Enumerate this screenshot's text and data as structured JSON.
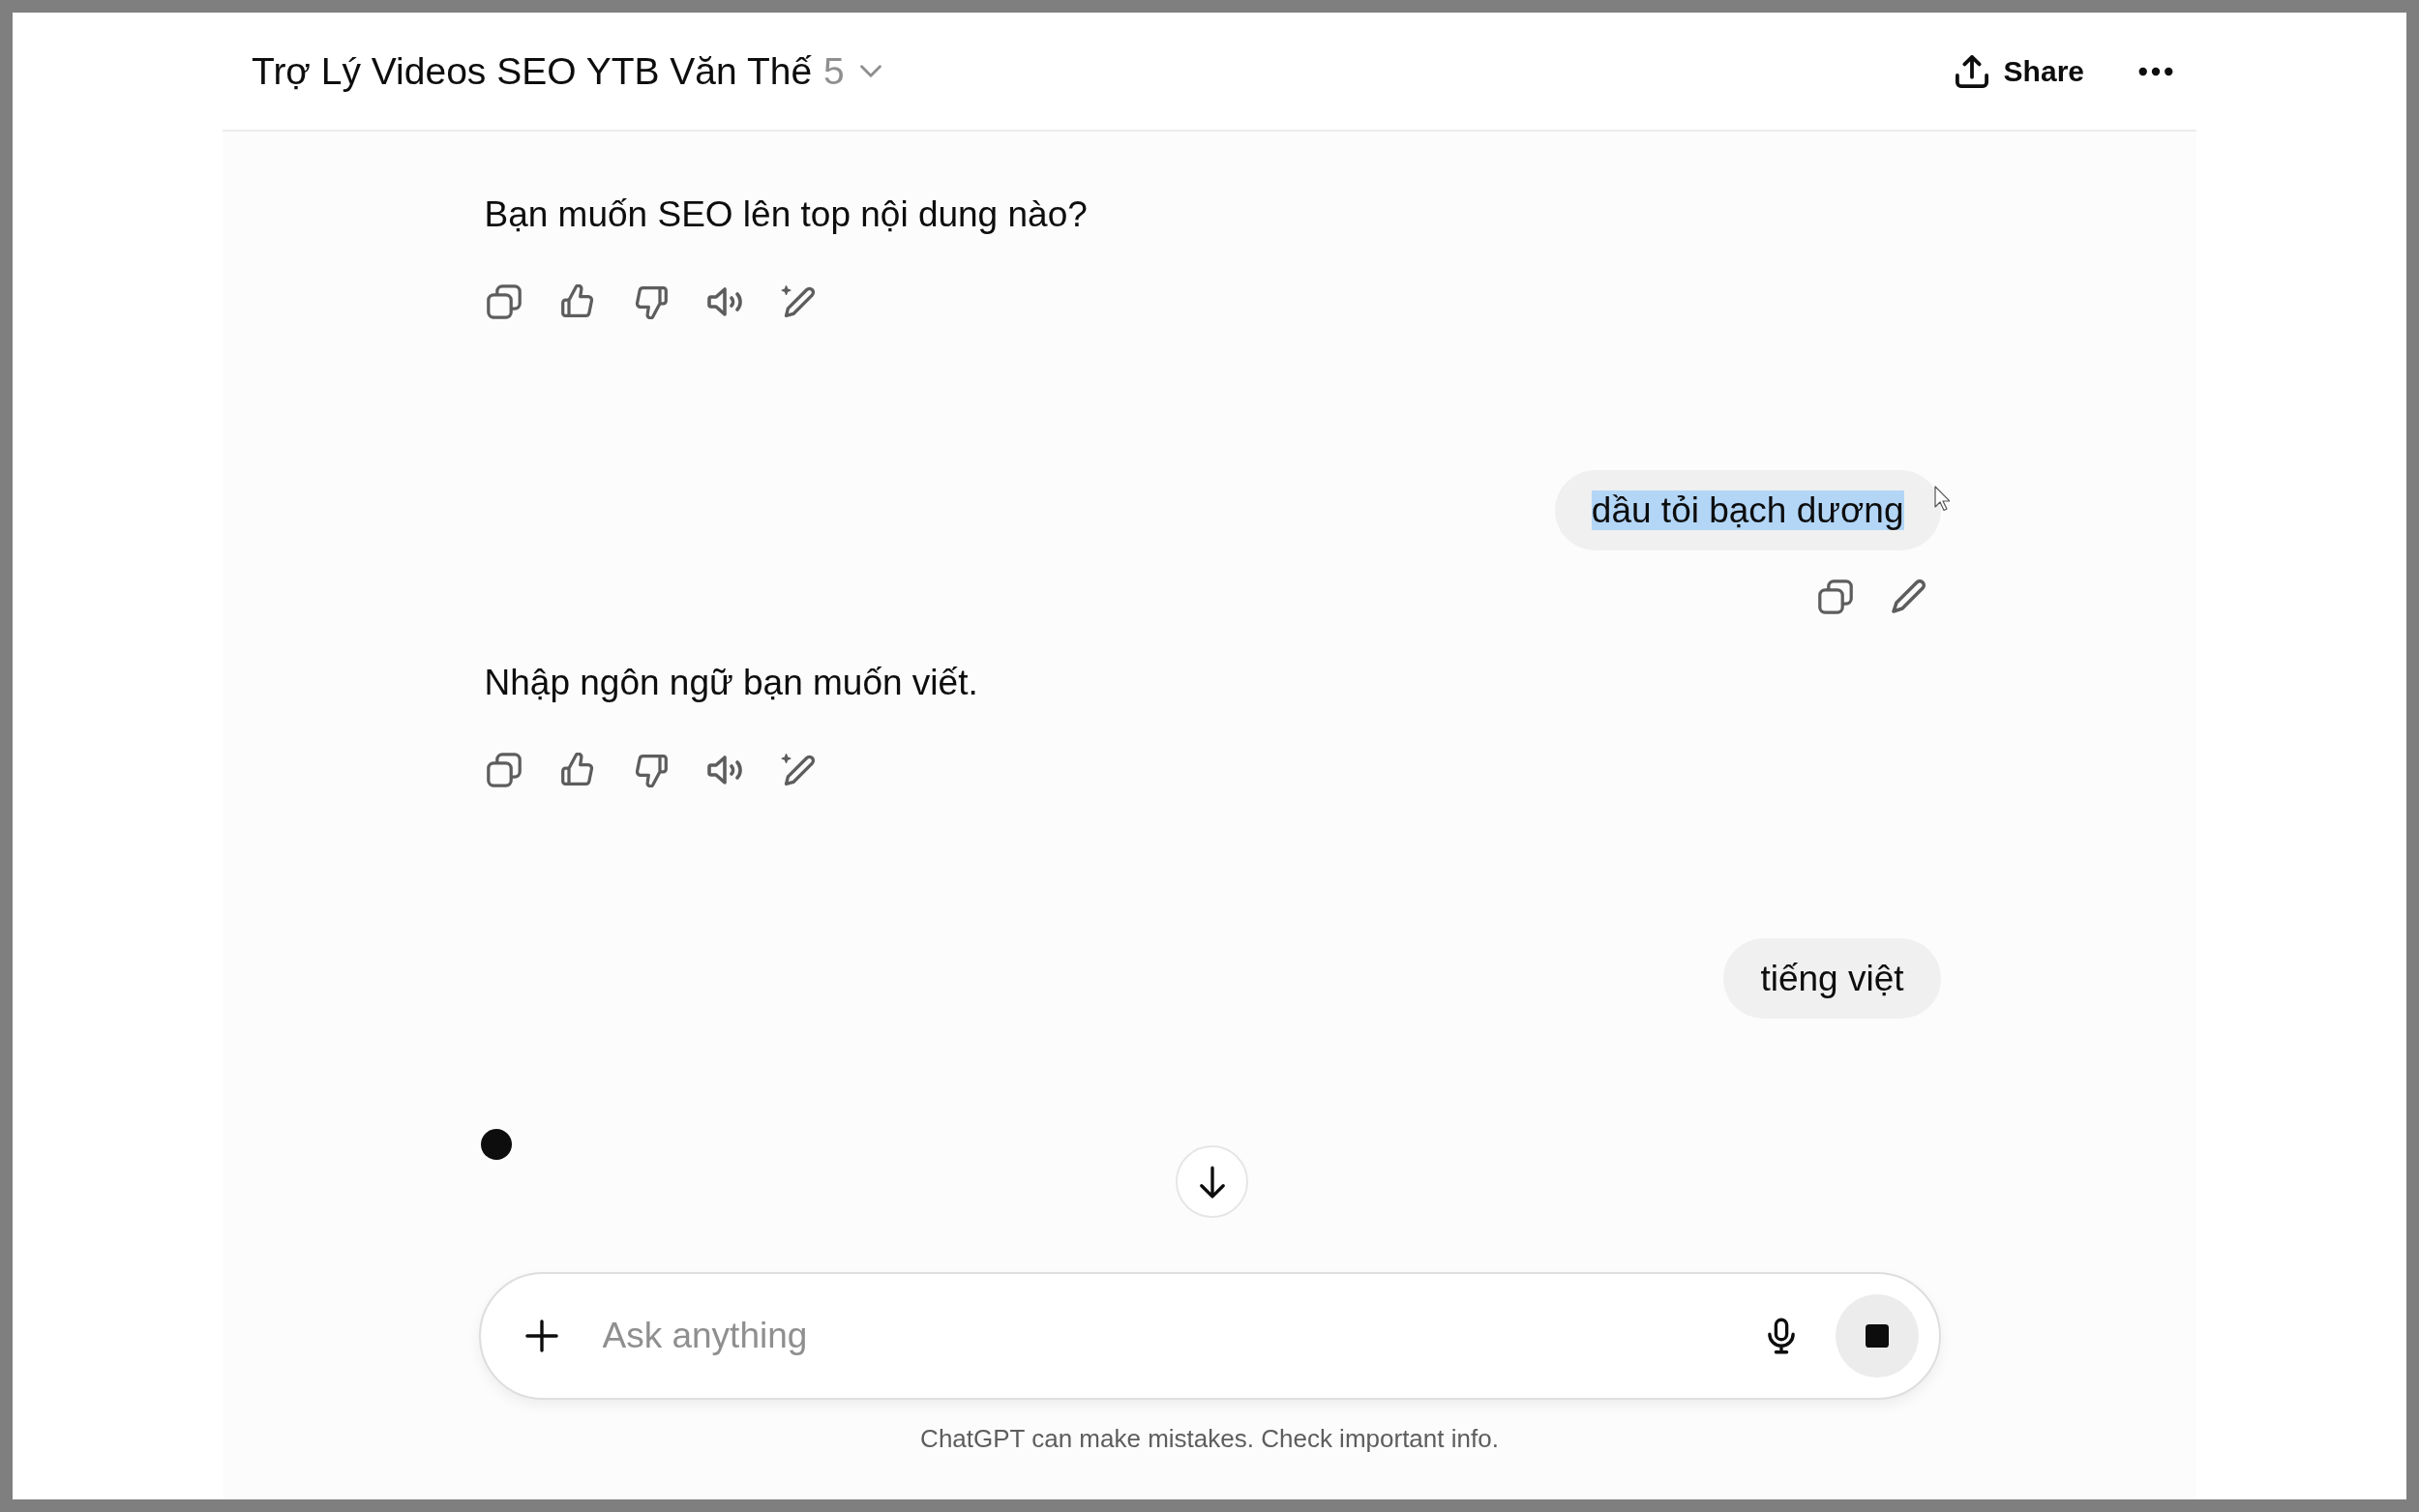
{
  "header": {
    "title": "Trợ Lý Videos SEO YTB Văn Thế",
    "version": "5",
    "share_label": "Share"
  },
  "messages": [
    {
      "kind": "assistant",
      "text": "Bạn muốn SEO lên top nội dung nào?"
    },
    {
      "kind": "user",
      "text": "dầu tỏi bạch dương",
      "highlighted": true,
      "hovered": true
    },
    {
      "kind": "assistant",
      "text": "Nhập ngôn ngữ bạn muốn viết."
    },
    {
      "kind": "user",
      "text": "tiếng việt",
      "highlighted": false,
      "hovered": false
    }
  ],
  "generating": true,
  "composer": {
    "placeholder": "Ask anything"
  },
  "footer": "ChatGPT can make mistakes. Check important info."
}
